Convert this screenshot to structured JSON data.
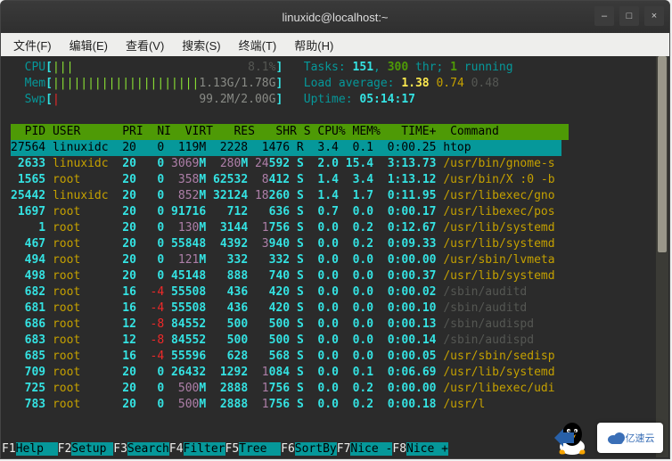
{
  "window": {
    "title": "linuxidc@localhost:~"
  },
  "window_controls": {
    "minimize": "–",
    "maximize": "□",
    "close": "×"
  },
  "menus": [
    {
      "label": "文件(F)"
    },
    {
      "label": "编辑(E)"
    },
    {
      "label": "查看(V)"
    },
    {
      "label": "搜索(S)"
    },
    {
      "label": "终端(T)"
    },
    {
      "label": "帮助(H)"
    }
  ],
  "meters": {
    "cpu": {
      "label": "CPU",
      "bar": "|||",
      "value": "8.1%"
    },
    "mem": {
      "label": "Mem",
      "bar": "|||||||||||||||||||||",
      "value": "1.13G/1.78G"
    },
    "swp": {
      "label": "Swp",
      "bar": "|",
      "value": "99.2M/2.00G"
    }
  },
  "sysinfo": {
    "tasks_label": "Tasks: ",
    "tasks_total": "151",
    "tasks_sep": ", ",
    "tasks_thr": "300",
    "tasks_thr_label": " thr; ",
    "tasks_running": "1",
    "tasks_running_label": " running",
    "load_label": "Load average: ",
    "load1": "1.38",
    "load2": "0.74",
    "load3": "0.48",
    "uptime_label": "Uptime: ",
    "uptime": "05:14:17"
  },
  "columns": "  PID USER      PRI  NI  VIRT   RES   SHR S CPU% MEM%   TIME+  Command          ",
  "rows": [
    {
      "pid": "27564",
      "user": "linuxidc",
      "pri": "20",
      "ni": "0",
      "virt": "119M",
      "res": "2228",
      "shr": "1476",
      "s": "R",
      "cpu": "3.4",
      "mem": "0.1",
      "time": "0:00.25",
      "cmd": "htop",
      "sel": true
    },
    {
      "pid": "2633",
      "user": "linuxidc",
      "pri": "20",
      "ni": "0",
      "virt": "3069M",
      "res": "280M",
      "shr": "24592",
      "s": "S",
      "cpu": "2.0",
      "mem": "15.4",
      "time": "3:13.73",
      "cmd": "/usr/bin/gnome-s"
    },
    {
      "pid": "1565",
      "user": "root",
      "pri": "20",
      "ni": "0",
      "virt": "358M",
      "res": "62532",
      "shr": "8412",
      "s": "S",
      "cpu": "1.4",
      "mem": "3.4",
      "time": "1:13.12",
      "cmd": "/usr/bin/X :0 -b"
    },
    {
      "pid": "25442",
      "user": "linuxidc",
      "pri": "20",
      "ni": "0",
      "virt": "852M",
      "res": "32124",
      "shr": "18260",
      "s": "S",
      "cpu": "1.4",
      "mem": "1.7",
      "time": "0:11.95",
      "cmd": "/usr/libexec/gno"
    },
    {
      "pid": "1697",
      "user": "root",
      "pri": "20",
      "ni": "0",
      "virt": "91716",
      "res": "712",
      "shr": "636",
      "s": "S",
      "cpu": "0.7",
      "mem": "0.0",
      "time": "0:00.17",
      "cmd": "/usr/libexec/pos"
    },
    {
      "pid": "1",
      "user": "root",
      "pri": "20",
      "ni": "0",
      "virt": "130M",
      "res": "3144",
      "shr": "1756",
      "s": "S",
      "cpu": "0.0",
      "mem": "0.2",
      "time": "0:12.67",
      "cmd": "/usr/lib/systemd"
    },
    {
      "pid": "467",
      "user": "root",
      "pri": "20",
      "ni": "0",
      "virt": "55848",
      "res": "4392",
      "shr": "3940",
      "s": "S",
      "cpu": "0.0",
      "mem": "0.2",
      "time": "0:09.33",
      "cmd": "/usr/lib/systemd"
    },
    {
      "pid": "494",
      "user": "root",
      "pri": "20",
      "ni": "0",
      "virt": "121M",
      "res": "332",
      "shr": "332",
      "s": "S",
      "cpu": "0.0",
      "mem": "0.0",
      "time": "0:00.00",
      "cmd": "/usr/sbin/lvmeta"
    },
    {
      "pid": "498",
      "user": "root",
      "pri": "20",
      "ni": "0",
      "virt": "45148",
      "res": "888",
      "shr": "740",
      "s": "S",
      "cpu": "0.0",
      "mem": "0.0",
      "time": "0:00.37",
      "cmd": "/usr/lib/systemd"
    },
    {
      "pid": "682",
      "user": "root",
      "pri": "16",
      "ni": "-4",
      "virt": "55508",
      "res": "436",
      "shr": "420",
      "s": "S",
      "cpu": "0.0",
      "mem": "0.0",
      "time": "0:00.02",
      "cmd": "/sbin/auditd",
      "dimcmd": true
    },
    {
      "pid": "681",
      "user": "root",
      "pri": "16",
      "ni": "-4",
      "virt": "55508",
      "res": "436",
      "shr": "420",
      "s": "S",
      "cpu": "0.0",
      "mem": "0.0",
      "time": "0:00.10",
      "cmd": "/sbin/auditd",
      "dimcmd": true
    },
    {
      "pid": "686",
      "user": "root",
      "pri": "12",
      "ni": "-8",
      "virt": "84552",
      "res": "500",
      "shr": "500",
      "s": "S",
      "cpu": "0.0",
      "mem": "0.0",
      "time": "0:00.13",
      "cmd": "/sbin/audispd",
      "dimcmd": true
    },
    {
      "pid": "683",
      "user": "root",
      "pri": "12",
      "ni": "-8",
      "virt": "84552",
      "res": "500",
      "shr": "500",
      "s": "S",
      "cpu": "0.0",
      "mem": "0.0",
      "time": "0:00.14",
      "cmd": "/sbin/audispd",
      "dimcmd": true
    },
    {
      "pid": "685",
      "user": "root",
      "pri": "16",
      "ni": "-4",
      "virt": "55596",
      "res": "628",
      "shr": "568",
      "s": "S",
      "cpu": "0.0",
      "mem": "0.0",
      "time": "0:00.05",
      "cmd": "/usr/sbin/sedisp"
    },
    {
      "pid": "709",
      "user": "root",
      "pri": "20",
      "ni": "0",
      "virt": "26432",
      "res": "1292",
      "shr": "1084",
      "s": "S",
      "cpu": "0.0",
      "mem": "0.1",
      "time": "0:06.69",
      "cmd": "/usr/lib/systemd"
    },
    {
      "pid": "725",
      "user": "root",
      "pri": "20",
      "ni": "0",
      "virt": "500M",
      "res": "2888",
      "shr": "1756",
      "s": "S",
      "cpu": "0.0",
      "mem": "0.2",
      "time": "0:00.00",
      "cmd": "/usr/libexec/udi"
    },
    {
      "pid": "783",
      "user": "root",
      "pri": "20",
      "ni": "0",
      "virt": "500M",
      "res": "2888",
      "shr": "1756",
      "s": "S",
      "cpu": "0.0",
      "mem": "0.2",
      "time": "0:00.18",
      "cmd": "/usr/l"
    }
  ],
  "fnkeys": [
    {
      "key": "F1",
      "label": "Help  "
    },
    {
      "key": "F2",
      "label": "Setup "
    },
    {
      "key": "F3",
      "label": "Search"
    },
    {
      "key": "F4",
      "label": "Filter"
    },
    {
      "key": "F5",
      "label": "Tree  "
    },
    {
      "key": "F6",
      "label": "SortBy"
    },
    {
      "key": "F7",
      "label": "Nice -"
    },
    {
      "key": "F8",
      "label": "Nice +"
    }
  ],
  "watermark": {
    "cloud": "亿速云"
  }
}
